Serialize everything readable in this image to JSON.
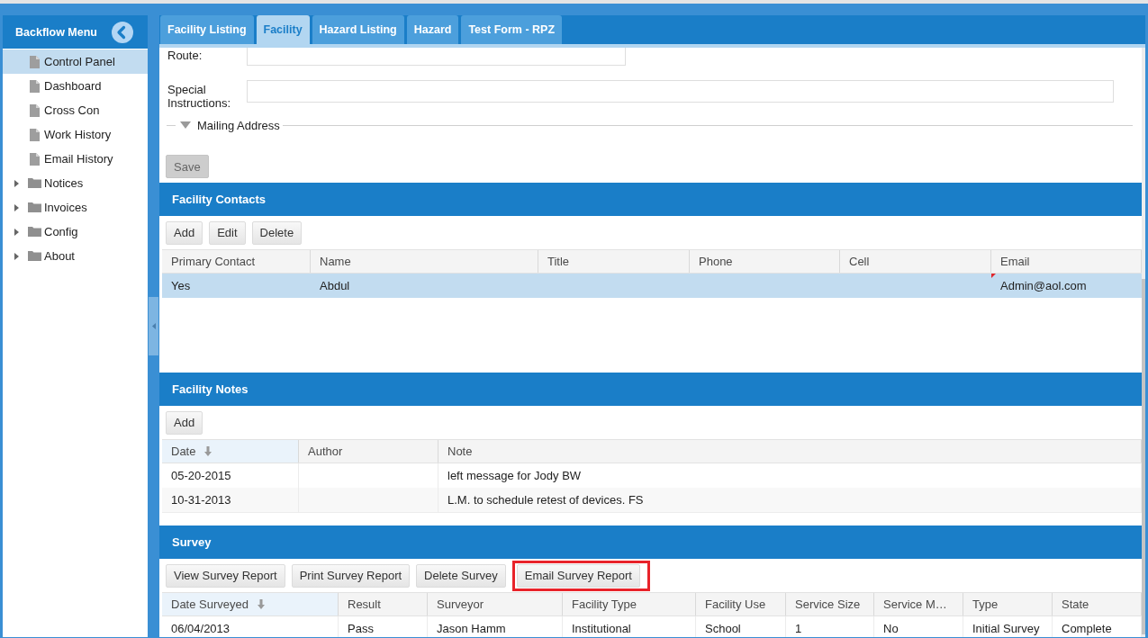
{
  "sidebar": {
    "title": "Backflow Menu",
    "items": [
      {
        "label": "Control Panel",
        "kind": "page",
        "selected": true
      },
      {
        "label": "Dashboard",
        "kind": "page",
        "selected": false
      },
      {
        "label": "Cross Con",
        "kind": "page",
        "selected": false
      },
      {
        "label": "Work History",
        "kind": "page",
        "selected": false
      },
      {
        "label": "Email History",
        "kind": "page",
        "selected": false
      },
      {
        "label": "Notices",
        "kind": "folder",
        "selected": false,
        "expanded": false
      },
      {
        "label": "Invoices",
        "kind": "folder",
        "selected": false,
        "expanded": false
      },
      {
        "label": "Config",
        "kind": "folder",
        "selected": false,
        "expanded": false
      },
      {
        "label": "About",
        "kind": "folder",
        "selected": false,
        "expanded": false
      }
    ]
  },
  "tabs": [
    {
      "label": "Facility Listing",
      "selected": false
    },
    {
      "label": "Facility",
      "selected": true
    },
    {
      "label": "Hazard Listing",
      "selected": false
    },
    {
      "label": "Hazard",
      "selected": false
    },
    {
      "label": "Test Form - RPZ",
      "selected": false
    }
  ],
  "form": {
    "fields": [
      {
        "label": "Route:",
        "kind": "short"
      },
      {
        "label": "Special Instructions:",
        "kind": "wide"
      }
    ],
    "fieldset": {
      "label": "Mailing Address"
    },
    "save_button": {
      "label": "Save",
      "disabled": true
    }
  },
  "contacts": {
    "title": "Facility Contacts",
    "buttons": [
      "Add",
      "Edit",
      "Delete"
    ],
    "table": {
      "columns": [
        {
          "label": "Primary Contact",
          "sorted": false
        },
        {
          "label": "Name",
          "sorted": false
        },
        {
          "label": "Title",
          "sorted": false
        },
        {
          "label": "Phone",
          "sorted": false
        },
        {
          "label": "Cell",
          "sorted": false
        },
        {
          "label": "Email",
          "sorted": false
        }
      ],
      "rows": [
        {
          "primary_contact": "Yes",
          "name": "Abdul",
          "email": "Admin@aol.com",
          "email_modified": true,
          "selected": true
        }
      ]
    }
  },
  "notes": {
    "title": "Facility Notes",
    "buttons": [
      "Add"
    ],
    "table": {
      "columns": [
        {
          "label": "Date",
          "sorted": true
        },
        {
          "label": "Author",
          "sorted": false
        },
        {
          "label": "Note",
          "sorted": false
        }
      ],
      "rows": [
        {
          "date": "05-20-2015",
          "note": "left message for Jody BW",
          "selected": false
        },
        {
          "date": "10-31-2013",
          "note": "L.M. to schedule retest of devices. FS",
          "selected": false
        }
      ]
    }
  },
  "survey": {
    "title": "Survey",
    "buttons": [
      {
        "label": "View Survey Report",
        "highlighted": false
      },
      {
        "label": "Print Survey Report",
        "highlighted": false
      },
      {
        "label": "Delete Survey",
        "highlighted": false
      },
      {
        "label": "Email Survey Report",
        "highlighted": true
      }
    ],
    "table": {
      "columns": [
        {
          "label": "Date Surveyed",
          "sorted": true
        },
        {
          "label": "Result",
          "sorted": false
        },
        {
          "label": "Surveyor",
          "sorted": false
        },
        {
          "label": "Facility Type",
          "sorted": false
        },
        {
          "label": "Facility Use",
          "sorted": false
        },
        {
          "label": "Service Size",
          "sorted": false
        },
        {
          "label": "Service M…",
          "sorted": false
        },
        {
          "label": "Type",
          "sorted": false
        },
        {
          "label": "State",
          "sorted": false
        }
      ],
      "rows": [
        {
          "cells": [
            "06/04/2013",
            "Pass",
            "Jason Hamm",
            "Institutional",
            "School",
            "1",
            "No",
            "Initial Survey",
            "Complete"
          ],
          "selected": false
        }
      ]
    }
  }
}
